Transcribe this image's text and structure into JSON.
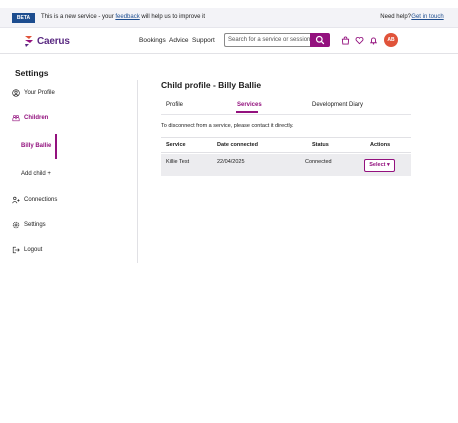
{
  "beta_bar": {
    "tag": "BETA",
    "text_before": "This is a new service - your ",
    "feedback_link": "feedback",
    "text_after": " will help us to improve it",
    "help_text": "Need help?",
    "help_link": "Get in touch"
  },
  "header": {
    "logo_text": "Caerus",
    "nav": [
      "Bookings",
      "Advice",
      "Support"
    ],
    "search_placeholder": "Search for a service or session",
    "avatar_initials": "AB",
    "colors": {
      "brand": "#93117e",
      "avatar": "#e0533a",
      "beta_tag": "#1d4d8f"
    }
  },
  "sidebar": {
    "title": "Settings",
    "your_profile": "Your Profile",
    "children": "Children",
    "child_billy": "Billy Ballie",
    "add_child": "Add child +",
    "connections": "Connections",
    "settings": "Settings",
    "logout": "Logout"
  },
  "main": {
    "title": "Child profile - Billy Ballie",
    "tabs": [
      "Profile",
      "Services",
      "Development Diary"
    ],
    "active_tab": "Services",
    "info": "To disconnect from a service, please contact it directly.",
    "table": {
      "headers": [
        "Service",
        "Date connected",
        "Status",
        "Actions"
      ],
      "rows": [
        {
          "service": "Killie Test",
          "date": "22/04/2025",
          "status": "Connected",
          "action": "Select ▾"
        }
      ]
    }
  }
}
